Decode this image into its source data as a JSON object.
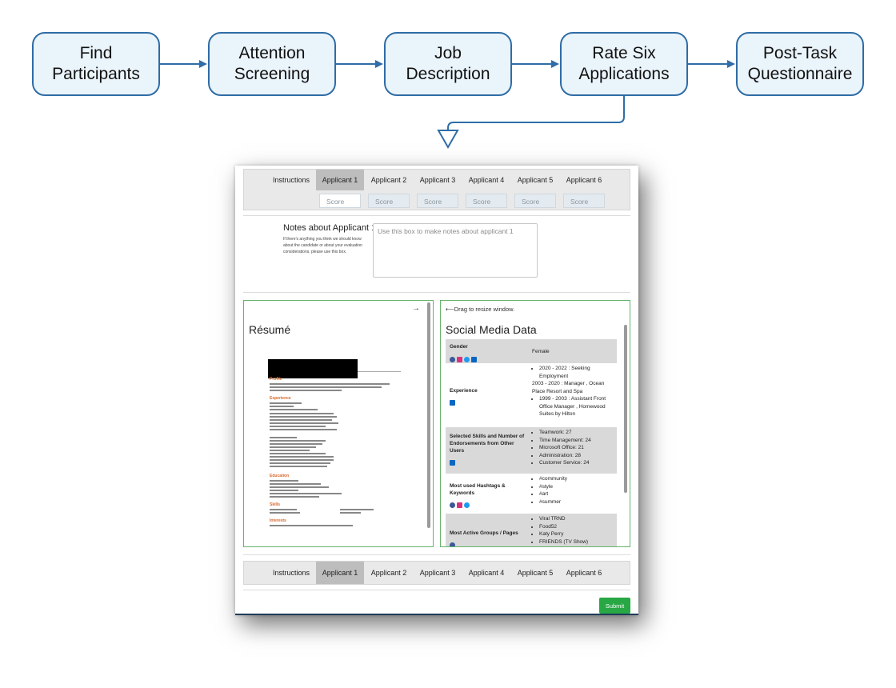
{
  "flow": {
    "steps": [
      {
        "line1": "Find",
        "line2": "Participants"
      },
      {
        "line1": "Attention",
        "line2": "Screening"
      },
      {
        "line1": "Job",
        "line2": "Description"
      },
      {
        "line1": "Rate Six",
        "line2": "Applications"
      },
      {
        "line1": "Post-Task",
        "line2": "Questionnaire"
      }
    ]
  },
  "tabs": {
    "labels": [
      "Instructions",
      "Applicant 1",
      "Applicant 2",
      "Applicant 3",
      "Applicant 4",
      "Applicant 5",
      "Applicant 6"
    ],
    "active_index": 1,
    "score_placeholder": "Score"
  },
  "notes": {
    "title": "Notes about Applicant 1:",
    "help": "If there's anything you think we should know about the candidate or about your evaluation considerations, please use this box.",
    "placeholder": "Use this box to make notes about applicant 1"
  },
  "resume": {
    "title": "Résumé",
    "arrow": "→",
    "sections": [
      "Profile",
      "Experience",
      "Education",
      "Skills",
      "Interests"
    ]
  },
  "social": {
    "drag_hint": "⟵Drag to resize window.",
    "title": "Social Media Data",
    "rows": [
      {
        "label": "Gender",
        "value": "Female"
      },
      {
        "label": "Experience",
        "items": [
          "2020 - 2022 : Seeking Employment",
          "2003 - 2020 : Manager , Ocean Place Resort and Spa",
          "1999 - 2003 : Assistant Front Office Manager , Homewood Suites by Hilton"
        ]
      },
      {
        "label": "Selected Skills and Number of Endorsements from Other Users",
        "items": [
          "Teamwork: 27",
          "Time Management: 24",
          "Microsoft Office: 21",
          "Administration: 28",
          "Customer Service: 24"
        ]
      },
      {
        "label": "Most used Hashtags & Keywords",
        "items": [
          "#community",
          "#style",
          "#art",
          "#summer"
        ]
      },
      {
        "label": "Most Active Groups / Pages",
        "items": [
          "Viral TRND",
          "Food52",
          "Katy Perry",
          "FRIENDS (TV Show)"
        ]
      }
    ]
  },
  "submit_label": "Submit",
  "colors": {
    "flow_border": "#2f6da6",
    "flow_fill": "#eaf4fb",
    "panel_border": "#66b36a",
    "submit": "#28a745",
    "resume_heading": "#d9672b"
  }
}
